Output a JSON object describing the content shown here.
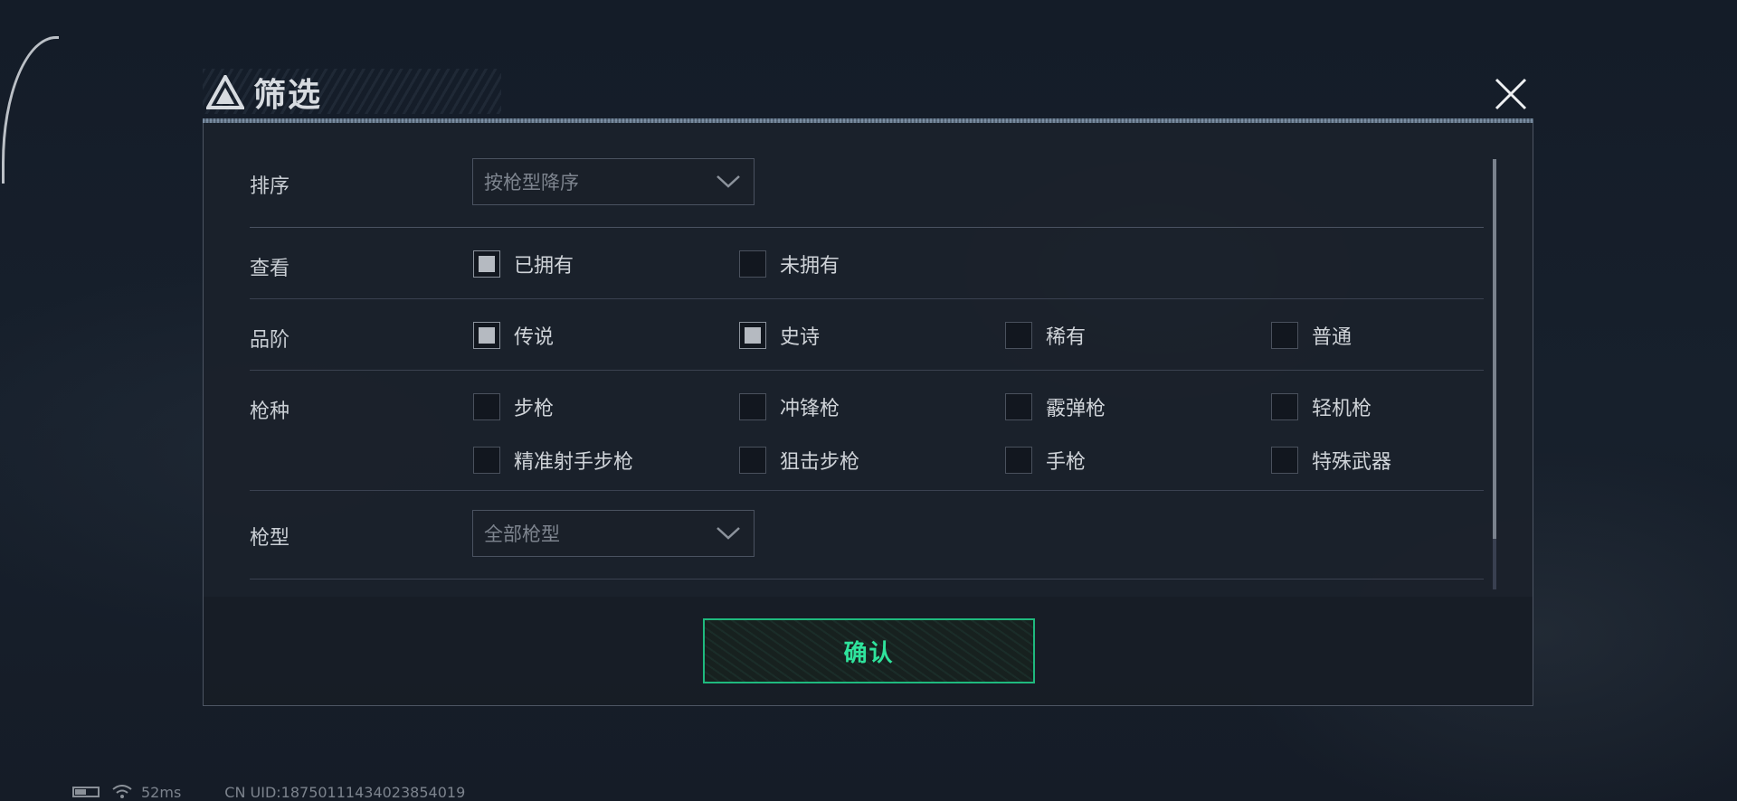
{
  "dialog": {
    "title": "筛选",
    "confirm_label": "确认"
  },
  "sort": {
    "label": "排序",
    "selected": "按枪型降序"
  },
  "view": {
    "label": "查看",
    "options": [
      {
        "label": "已拥有",
        "checked": true
      },
      {
        "label": "未拥有",
        "checked": false
      }
    ]
  },
  "rarity": {
    "label": "品阶",
    "options": [
      {
        "label": "传说",
        "checked": true
      },
      {
        "label": "史诗",
        "checked": true
      },
      {
        "label": "稀有",
        "checked": false
      },
      {
        "label": "普通",
        "checked": false
      }
    ]
  },
  "weapon_class": {
    "label": "枪种",
    "options": [
      {
        "label": "步枪",
        "checked": false
      },
      {
        "label": "冲锋枪",
        "checked": false
      },
      {
        "label": "霰弹枪",
        "checked": false
      },
      {
        "label": "轻机枪",
        "checked": false
      },
      {
        "label": "精准射手步枪",
        "checked": false
      },
      {
        "label": "狙击步枪",
        "checked": false
      },
      {
        "label": "手枪",
        "checked": false
      },
      {
        "label": "特殊武器",
        "checked": false
      }
    ]
  },
  "weapon_model": {
    "label": "枪型",
    "selected": "全部枪型"
  },
  "status_bar": {
    "ping": "52ms",
    "uid": "CN UID:18750111434023854019"
  },
  "colors": {
    "accent": "#2fe39c",
    "dialog_bg": "#1b212b"
  }
}
